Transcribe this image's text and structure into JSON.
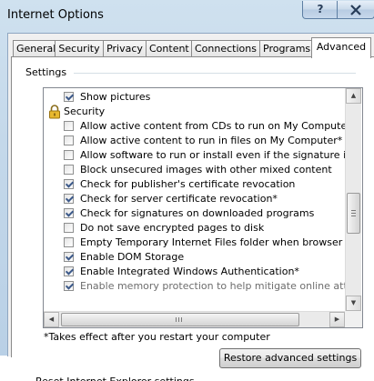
{
  "window": {
    "title": "Internet Options",
    "help_glyph": "?",
    "close_glyph": "X"
  },
  "tabs": [
    {
      "label": "General"
    },
    {
      "label": "Security"
    },
    {
      "label": "Privacy"
    },
    {
      "label": "Content"
    },
    {
      "label": "Connections"
    },
    {
      "label": "Programs"
    },
    {
      "label": "Advanced",
      "active": true
    }
  ],
  "settings": {
    "group_label": "Settings",
    "items": [
      {
        "type": "checkbox",
        "label": "Show pictures",
        "checked": true
      },
      {
        "type": "category",
        "label": "Security",
        "icon": "lock-icon"
      },
      {
        "type": "checkbox",
        "label": "Allow active content from CDs to run on My Computer*",
        "checked": false
      },
      {
        "type": "checkbox",
        "label": "Allow active content to run in files on My Computer*",
        "checked": false
      },
      {
        "type": "checkbox",
        "label": "Allow software to run or install even if the signature is inva",
        "checked": false
      },
      {
        "type": "checkbox",
        "label": "Block unsecured images with other mixed content",
        "checked": false
      },
      {
        "type": "checkbox",
        "label": "Check for publisher's certificate revocation",
        "checked": true
      },
      {
        "type": "checkbox",
        "label": "Check for server certificate revocation*",
        "checked": true
      },
      {
        "type": "checkbox",
        "label": "Check for signatures on downloaded programs",
        "checked": true
      },
      {
        "type": "checkbox",
        "label": "Do not save encrypted pages to disk",
        "checked": false
      },
      {
        "type": "checkbox",
        "label": "Empty Temporary Internet Files folder when browser is clo",
        "checked": false
      },
      {
        "type": "checkbox",
        "label": "Enable DOM Storage",
        "checked": true
      },
      {
        "type": "checkbox",
        "label": "Enable Integrated Windows Authentication*",
        "checked": true
      },
      {
        "type": "checkbox",
        "label": "Enable memory protection to help mitigate online attacks*",
        "checked": true,
        "disabled": true
      }
    ],
    "scroll_position": 0.55
  },
  "note": "*Takes effect after you restart your computer",
  "restore_button": "Restore advanced settings",
  "bottom_group_label": "Reset Internet Explorer settings"
}
